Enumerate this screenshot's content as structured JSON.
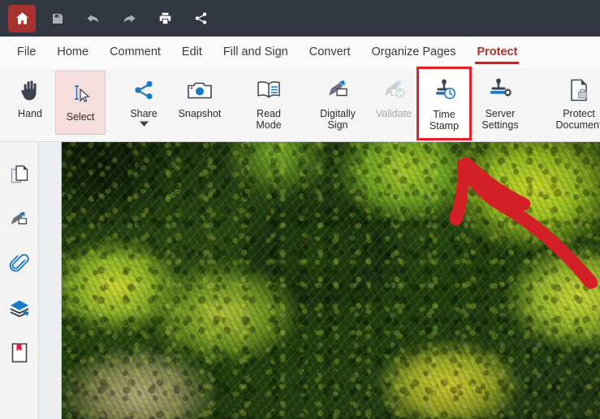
{
  "app": {
    "accent_red": "#a8312f",
    "highlight_red": "#ee1c25",
    "titlebar_bg": "#323741",
    "ribbon_bg": "#f5f5f5",
    "icon_blue": "#1878c8",
    "icon_dark": "#3b4350"
  },
  "quick_access": {
    "items": [
      {
        "name": "home-button",
        "icon": "home-icon",
        "label": "Home"
      },
      {
        "name": "save-button",
        "icon": "save-icon",
        "label": "Save"
      },
      {
        "name": "undo-button",
        "icon": "undo-arrow-icon",
        "label": "Undo"
      },
      {
        "name": "redo-button",
        "icon": "redo-arrow-icon",
        "label": "Redo"
      },
      {
        "name": "print-button",
        "icon": "printer-icon",
        "label": "Print"
      },
      {
        "name": "share-button",
        "icon": "share-nodes-icon",
        "label": "Share"
      }
    ]
  },
  "menu": {
    "tabs": [
      {
        "label": "File",
        "active": false
      },
      {
        "label": "Home",
        "active": false
      },
      {
        "label": "Comment",
        "active": false
      },
      {
        "label": "Edit",
        "active": false
      },
      {
        "label": "Fill and Sign",
        "active": false
      },
      {
        "label": "Convert",
        "active": false
      },
      {
        "label": "Organize Pages",
        "active": false
      },
      {
        "label": "Protect",
        "active": true
      }
    ]
  },
  "ribbon": {
    "groups": [
      {
        "items": [
          {
            "label": "Hand",
            "icon": "hand-icon",
            "state": "normal"
          },
          {
            "label": "Select",
            "icon": "text-select-icon",
            "state": "selected"
          }
        ]
      },
      {
        "items": [
          {
            "label": "Share",
            "icon": "share-nodes-icon",
            "state": "normal",
            "has_dropdown": true
          },
          {
            "label": "Snapshot",
            "icon": "camera-icon",
            "state": "normal"
          }
        ]
      },
      {
        "items": [
          {
            "label": "Read\nMode",
            "label_line1": "Read",
            "label_line2": "Mode",
            "icon": "open-book-icon",
            "state": "normal"
          }
        ]
      },
      {
        "items": [
          {
            "label_line1": "Digitally",
            "label_line2": "Sign",
            "icon": "digital-sign-icon",
            "state": "normal"
          },
          {
            "label_line1": "Validate",
            "label_line2": "",
            "icon": "validate-sign-icon",
            "state": "disabled"
          },
          {
            "label_line1": "Time",
            "label_line2": "Stamp",
            "icon": "time-stamp-icon",
            "state": "highlighted"
          },
          {
            "label_line1": "Server",
            "label_line2": "Settings",
            "icon": "server-settings-icon",
            "state": "normal"
          }
        ]
      },
      {
        "items": [
          {
            "label_line1": "Protect",
            "label_line2": "Document",
            "icon": "protect-document-icon",
            "state": "normal"
          }
        ]
      }
    ]
  },
  "sidebar": {
    "items": [
      {
        "name": "page-thumbnails",
        "icon": "pages-icon"
      },
      {
        "name": "signatures",
        "icon": "digital-sign-icon"
      },
      {
        "name": "attachments",
        "icon": "paperclip-icon"
      },
      {
        "name": "layers",
        "icon": "layers-icon"
      },
      {
        "name": "bookmarks",
        "icon": "bookmark-icon"
      }
    ]
  },
  "document": {
    "page_description": "Aerial photograph of a forest canopy with green and yellow foliage",
    "annotation": {
      "type": "arrow",
      "color": "#d32027",
      "points_to": "Time Stamp"
    }
  }
}
